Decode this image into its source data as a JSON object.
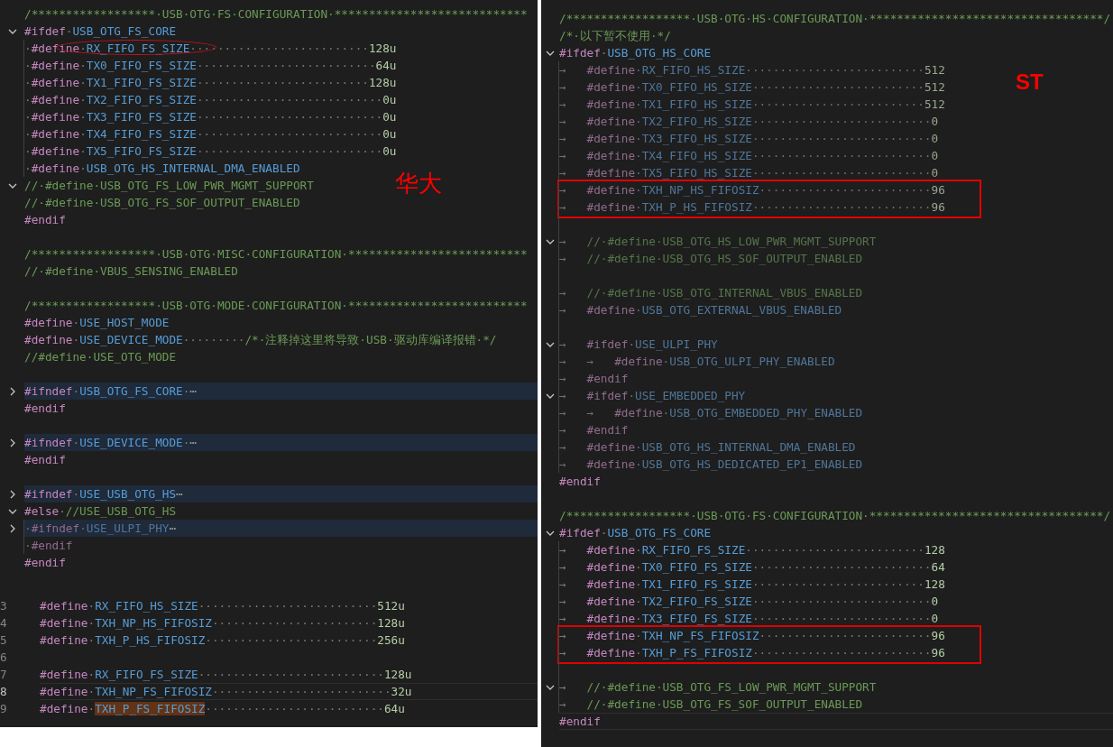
{
  "panels": [
    {
      "lines": [
        {
          "t": [
            {
              "kind": "cm",
              "text": "/******************·USB·OTG·FS·CONFIGURATION·****************************"
            }
          ]
        },
        {
          "expanded": true,
          "t": [
            {
              "kind": "dir",
              "text": "#ifdef"
            },
            {
              "kind": "ws",
              "text": "·"
            },
            {
              "kind": "mac",
              "text": "USB_OTG_FS_CORE"
            }
          ]
        },
        {
          "guide": true,
          "t": [
            {
              "kind": "ws",
              "text": "·"
            },
            {
              "kind": "dir",
              "text": "#define"
            },
            {
              "kind": "ws",
              "text": "·"
            },
            {
              "kind": "circ",
              "text": "RX_FIFO_FS_SIZE"
            },
            {
              "kind": "ws",
              "text": "··························"
            },
            {
              "kind": "num",
              "text": "128u"
            }
          ]
        },
        {
          "guide": true,
          "t": [
            {
              "kind": "ws",
              "text": "·"
            },
            {
              "kind": "dir",
              "text": "#define"
            },
            {
              "kind": "ws",
              "text": "·"
            },
            {
              "kind": "mac",
              "text": "TX0_FIFO_FS_SIZE"
            },
            {
              "kind": "ws",
              "text": "··························"
            },
            {
              "kind": "num",
              "text": "64u"
            }
          ]
        },
        {
          "guide": true,
          "t": [
            {
              "kind": "ws",
              "text": "·"
            },
            {
              "kind": "dir",
              "text": "#define"
            },
            {
              "kind": "ws",
              "text": "·"
            },
            {
              "kind": "mac",
              "text": "TX1_FIFO_FS_SIZE"
            },
            {
              "kind": "ws",
              "text": "·························"
            },
            {
              "kind": "num",
              "text": "128u"
            }
          ]
        },
        {
          "guide": true,
          "t": [
            {
              "kind": "ws",
              "text": "·"
            },
            {
              "kind": "dir",
              "text": "#define"
            },
            {
              "kind": "ws",
              "text": "·"
            },
            {
              "kind": "mac",
              "text": "TX2_FIFO_FS_SIZE"
            },
            {
              "kind": "ws",
              "text": "···························"
            },
            {
              "kind": "num",
              "text": "0u"
            }
          ]
        },
        {
          "guide": true,
          "t": [
            {
              "kind": "ws",
              "text": "·"
            },
            {
              "kind": "dir",
              "text": "#define"
            },
            {
              "kind": "ws",
              "text": "·"
            },
            {
              "kind": "mac",
              "text": "TX3_FIFO_FS_SIZE"
            },
            {
              "kind": "ws",
              "text": "···························"
            },
            {
              "kind": "num",
              "text": "0u"
            }
          ]
        },
        {
          "guide": true,
          "t": [
            {
              "kind": "ws",
              "text": "·"
            },
            {
              "kind": "dir",
              "text": "#define"
            },
            {
              "kind": "ws",
              "text": "·"
            },
            {
              "kind": "mac",
              "text": "TX4_FIFO_FS_SIZE"
            },
            {
              "kind": "ws",
              "text": "···························"
            },
            {
              "kind": "num",
              "text": "0u"
            }
          ]
        },
        {
          "guide": true,
          "t": [
            {
              "kind": "ws",
              "text": "·"
            },
            {
              "kind": "dir",
              "text": "#define"
            },
            {
              "kind": "ws",
              "text": "·"
            },
            {
              "kind": "mac",
              "text": "TX5_FIFO_FS_SIZE"
            },
            {
              "kind": "ws",
              "text": "···························"
            },
            {
              "kind": "num",
              "text": "0u"
            }
          ]
        },
        {
          "guide": true,
          "t": [
            {
              "kind": "ws",
              "text": "·"
            },
            {
              "kind": "dir",
              "text": "#define"
            },
            {
              "kind": "ws",
              "text": "·"
            },
            {
              "kind": "mac",
              "text": "USB_OTG_HS_INTERNAL_DMA_ENABLED"
            }
          ]
        },
        {
          "expanded": true,
          "note": "华大",
          "t": [
            {
              "kind": "cm",
              "text": "//·#define·USB_OTG_FS_LOW_PWR_MGMT_SUPPORT"
            }
          ]
        },
        {
          "t": [
            {
              "kind": "cm",
              "text": "//·#define·USB_OTG_FS_SOF_OUTPUT_ENABLED"
            }
          ]
        },
        {
          "t": [
            {
              "kind": "dir",
              "text": "#endif"
            }
          ]
        },
        {
          "gap": true,
          "t": [
            {
              "kind": "cm",
              "text": "/******************·USB·OTG·MISC·CONFIGURATION·**************************"
            }
          ]
        },
        {
          "t": [
            {
              "kind": "cm",
              "text": "//·#define·VBUS_SENSING_ENABLED"
            }
          ]
        },
        {
          "gap": true,
          "t": [
            {
              "kind": "cm",
              "text": "/******************·USB·OTG·MODE·CONFIGURATION·**************************"
            }
          ]
        },
        {
          "t": [
            {
              "kind": "dir",
              "text": "#define"
            },
            {
              "kind": "ws",
              "text": "·"
            },
            {
              "kind": "mac",
              "text": "USE_HOST_MODE"
            }
          ]
        },
        {
          "t": [
            {
              "kind": "dir",
              "text": "#define"
            },
            {
              "kind": "ws",
              "text": "·"
            },
            {
              "kind": "mac",
              "text": "USE_DEVICE_MODE"
            },
            {
              "kind": "ws",
              "text": "·········"
            },
            {
              "kind": "cm",
              "text": "/*·注释掉这里将导致·USB·驱动库编译报错·*/"
            }
          ]
        },
        {
          "t": [
            {
              "kind": "cm",
              "text": "//#define·USE_OTG_MODE"
            }
          ]
        },
        {
          "gap": true,
          "expanded": false,
          "hl": true,
          "t": [
            {
              "kind": "dir",
              "text": "#ifndef"
            },
            {
              "kind": "ws",
              "text": "·"
            },
            {
              "kind": "mac",
              "text": "USB_OTG_FS_CORE"
            },
            {
              "kind": "ws",
              "text": "·"
            },
            {
              "kind": "more",
              "text": "⋯"
            }
          ]
        },
        {
          "t": [
            {
              "kind": "dir",
              "text": "#endif"
            }
          ]
        },
        {
          "gap": true,
          "expanded": false,
          "hl": true,
          "t": [
            {
              "kind": "dir",
              "text": "#ifndef"
            },
            {
              "kind": "ws",
              "text": "·"
            },
            {
              "kind": "mac",
              "text": "USE_DEVICE_MODE"
            },
            {
              "kind": "ws",
              "text": "·"
            },
            {
              "kind": "more",
              "text": "⋯"
            }
          ]
        },
        {
          "t": [
            {
              "kind": "dir",
              "text": "#endif"
            }
          ]
        },
        {
          "gap": true,
          "expanded": false,
          "hl": true,
          "t": [
            {
              "kind": "dir",
              "text": "#ifndef"
            },
            {
              "kind": "ws",
              "text": "·"
            },
            {
              "kind": "mac",
              "text": "USE_USB_OTG_HS"
            },
            {
              "kind": "more",
              "text": "⋯"
            }
          ]
        },
        {
          "expanded": true,
          "t": [
            {
              "kind": "dir",
              "text": "#else"
            },
            {
              "kind": "ws",
              "text": "·"
            },
            {
              "kind": "cm",
              "text": "//USE_USB_OTG_HS"
            }
          ]
        },
        {
          "expanded": false,
          "hl": true,
          "guide": true,
          "inactive": true,
          "t": [
            {
              "kind": "ws",
              "text": "·"
            },
            {
              "kind": "dir",
              "text": "#ifndef"
            },
            {
              "kind": "ws",
              "text": "·"
            },
            {
              "kind": "mac",
              "text": "USE_ULPI_PHY"
            },
            {
              "kind": "more",
              "text": "⋯"
            }
          ]
        },
        {
          "guide": true,
          "inactive": true,
          "t": [
            {
              "kind": "ws",
              "text": "·"
            },
            {
              "kind": "dir",
              "text": "#endif"
            }
          ]
        },
        {
          "t": [
            {
              "kind": "dir",
              "text": "#endif"
            }
          ]
        }
      ]
    },
    {
      "lines": [
        {
          "n": "3",
          "t": [
            {
              "kind": "dir",
              "text": "#define"
            },
            {
              "kind": "ws",
              "text": "·"
            },
            {
              "kind": "mac",
              "text": "RX_FIFO_HS_SIZE"
            },
            {
              "kind": "ws",
              "text": "··························"
            },
            {
              "kind": "num",
              "text": "512u"
            }
          ]
        },
        {
          "n": "4",
          "t": [
            {
              "kind": "dir",
              "text": "#define"
            },
            {
              "kind": "ws",
              "text": "·"
            },
            {
              "kind": "mac",
              "text": "TXH_NP_HS_FIFOSIZ"
            },
            {
              "kind": "ws",
              "text": "························"
            },
            {
              "kind": "num",
              "text": "128u"
            }
          ]
        },
        {
          "n": "5",
          "t": [
            {
              "kind": "dir",
              "text": "#define"
            },
            {
              "kind": "ws",
              "text": "·"
            },
            {
              "kind": "mac",
              "text": "TXH_P_HS_FIFOSIZ"
            },
            {
              "kind": "ws",
              "text": "·························"
            },
            {
              "kind": "num",
              "text": "256u"
            }
          ]
        },
        {
          "n": "6"
        },
        {
          "n": "7",
          "t": [
            {
              "kind": "dir",
              "text": "#define"
            },
            {
              "kind": "ws",
              "text": "·"
            },
            {
              "kind": "mac",
              "text": "RX_FIFO_FS_SIZE"
            },
            {
              "kind": "ws",
              "text": "···························"
            },
            {
              "kind": "num",
              "text": "128u"
            }
          ]
        },
        {
          "n": "8",
          "current": true,
          "t": [
            {
              "kind": "dir",
              "text": "#define"
            },
            {
              "kind": "ws",
              "text": "·"
            },
            {
              "kind": "mac",
              "text": "TXH_NP_FS_FIFOSIZ"
            },
            {
              "kind": "ws",
              "text": "··························"
            },
            {
              "kind": "num",
              "text": "32u"
            }
          ]
        },
        {
          "n": "9",
          "t": [
            {
              "kind": "dir",
              "text": "#define"
            },
            {
              "kind": "ws",
              "text": "·"
            },
            {
              "kind": "sel",
              "text": "TXH_P_FS_FIFOSIZ"
            },
            {
              "kind": "ws",
              "text": "··························"
            },
            {
              "kind": "num",
              "text": "64u"
            }
          ]
        }
      ]
    },
    {
      "lines": [
        {
          "t": [
            {
              "kind": "cm",
              "text": "/******************·USB·OTG·HS·CONFIGURATION·**********************************/"
            }
          ]
        },
        {
          "t": [
            {
              "kind": "cm",
              "text": "/*·以下暂不使用·*/"
            }
          ]
        },
        {
          "expanded": true,
          "t": [
            {
              "kind": "dir",
              "text": "#ifdef"
            },
            {
              "kind": "ws",
              "text": "·"
            },
            {
              "kind": "mac",
              "text": "USB_OTG_HS_CORE"
            }
          ]
        },
        {
          "guide": true,
          "inactive": true,
          "t": [
            {
              "kind": "tab",
              "text": "→   "
            },
            {
              "kind": "dir",
              "text": "#define"
            },
            {
              "kind": "ws",
              "text": "·"
            },
            {
              "kind": "mac",
              "text": "RX_FIFO_HS_SIZE"
            },
            {
              "kind": "ws",
              "text": "··························"
            },
            {
              "kind": "num",
              "text": "512"
            }
          ]
        },
        {
          "guide": true,
          "inactive": true,
          "note": "ST",
          "t": [
            {
              "kind": "tab",
              "text": "→   "
            },
            {
              "kind": "dir",
              "text": "#define"
            },
            {
              "kind": "ws",
              "text": "·"
            },
            {
              "kind": "mac",
              "text": "TX0_FIFO_HS_SIZE"
            },
            {
              "kind": "ws",
              "text": "·························"
            },
            {
              "kind": "num",
              "text": "512"
            }
          ]
        },
        {
          "guide": true,
          "inactive": true,
          "t": [
            {
              "kind": "tab",
              "text": "→   "
            },
            {
              "kind": "dir",
              "text": "#define"
            },
            {
              "kind": "ws",
              "text": "·"
            },
            {
              "kind": "mac",
              "text": "TX1_FIFO_HS_SIZE"
            },
            {
              "kind": "ws",
              "text": "·························"
            },
            {
              "kind": "num",
              "text": "512"
            }
          ]
        },
        {
          "guide": true,
          "inactive": true,
          "t": [
            {
              "kind": "tab",
              "text": "→   "
            },
            {
              "kind": "dir",
              "text": "#define"
            },
            {
              "kind": "ws",
              "text": "·"
            },
            {
              "kind": "mac",
              "text": "TX2_FIFO_HS_SIZE"
            },
            {
              "kind": "ws",
              "text": "··························"
            },
            {
              "kind": "num",
              "text": "0"
            }
          ]
        },
        {
          "guide": true,
          "inactive": true,
          "t": [
            {
              "kind": "tab",
              "text": "→   "
            },
            {
              "kind": "dir",
              "text": "#define"
            },
            {
              "kind": "ws",
              "text": "·"
            },
            {
              "kind": "mac",
              "text": "TX3_FIFO_HS_SIZE"
            },
            {
              "kind": "ws",
              "text": "··························"
            },
            {
              "kind": "num",
              "text": "0"
            }
          ]
        },
        {
          "guide": true,
          "inactive": true,
          "t": [
            {
              "kind": "tab",
              "text": "→   "
            },
            {
              "kind": "dir",
              "text": "#define"
            },
            {
              "kind": "ws",
              "text": "·"
            },
            {
              "kind": "mac",
              "text": "TX4_FIFO_HS_SIZE"
            },
            {
              "kind": "ws",
              "text": "··························"
            },
            {
              "kind": "num",
              "text": "0"
            }
          ]
        },
        {
          "guide": true,
          "inactive": true,
          "t": [
            {
              "kind": "tab",
              "text": "→   "
            },
            {
              "kind": "dir",
              "text": "#define"
            },
            {
              "kind": "ws",
              "text": "·"
            },
            {
              "kind": "mac",
              "text": "TX5_FIFO_HS_SIZE"
            },
            {
              "kind": "ws",
              "text": "··························"
            },
            {
              "kind": "num",
              "text": "0"
            }
          ]
        },
        {
          "guide": true,
          "inactive": true,
          "boxed": true,
          "t": [
            {
              "kind": "tab",
              "text": "→   "
            },
            {
              "kind": "dir",
              "text": "#define"
            },
            {
              "kind": "ws",
              "text": "·"
            },
            {
              "kind": "mac",
              "text": "TXH_NP_HS_FIFOSIZ"
            },
            {
              "kind": "ws",
              "text": "·························"
            },
            {
              "kind": "num",
              "text": "96"
            }
          ]
        },
        {
          "guide": true,
          "inactive": true,
          "boxed": true,
          "t": [
            {
              "kind": "tab",
              "text": "→   "
            },
            {
              "kind": "dir",
              "text": "#define"
            },
            {
              "kind": "ws",
              "text": "·"
            },
            {
              "kind": "mac",
              "text": "TXH_P_HS_FIFOSIZ"
            },
            {
              "kind": "ws",
              "text": "··························"
            },
            {
              "kind": "num",
              "text": "96"
            }
          ]
        },
        {
          "guide": true
        },
        {
          "expanded": true,
          "guide": true,
          "inactive": true,
          "t": [
            {
              "kind": "tab",
              "text": "→   "
            },
            {
              "kind": "cm",
              "text": "//·#define·USB_OTG_HS_LOW_PWR_MGMT_SUPPORT"
            }
          ]
        },
        {
          "guide": true,
          "inactive": true,
          "t": [
            {
              "kind": "tab",
              "text": "→   "
            },
            {
              "kind": "cm",
              "text": "//·#define·USB_OTG_HS_SOF_OUTPUT_ENABLED"
            }
          ]
        },
        {
          "guide": true
        },
        {
          "guide": true,
          "inactive": true,
          "t": [
            {
              "kind": "tab",
              "text": "→   "
            },
            {
              "kind": "cm",
              "text": "//·#define·USB_OTG_INTERNAL_VBUS_ENABLED"
            }
          ]
        },
        {
          "guide": true,
          "inactive": true,
          "t": [
            {
              "kind": "tab",
              "text": "→   "
            },
            {
              "kind": "dir",
              "text": "#define"
            },
            {
              "kind": "ws",
              "text": "·"
            },
            {
              "kind": "mac",
              "text": "USB_OTG_EXTERNAL_VBUS_ENABLED"
            }
          ]
        },
        {
          "guide": true
        },
        {
          "expanded": true,
          "guide": true,
          "inactive": true,
          "t": [
            {
              "kind": "tab",
              "text": "→   "
            },
            {
              "kind": "dir",
              "text": "#ifdef"
            },
            {
              "kind": "ws",
              "text": "·"
            },
            {
              "kind": "mac",
              "text": "USE_ULPI_PHY"
            }
          ]
        },
        {
          "guide": true,
          "inactive": true,
          "t": [
            {
              "kind": "tab",
              "text": "→   "
            },
            {
              "kind": "tab",
              "text": "→   "
            },
            {
              "kind": "dir",
              "text": "#define"
            },
            {
              "kind": "ws",
              "text": "·"
            },
            {
              "kind": "mac",
              "text": "USB_OTG_ULPI_PHY_ENABLED"
            }
          ]
        },
        {
          "guide": true,
          "inactive": true,
          "t": [
            {
              "kind": "tab",
              "text": "→   "
            },
            {
              "kind": "dir",
              "text": "#endif"
            }
          ]
        },
        {
          "expanded": true,
          "guide": true,
          "inactive": true,
          "t": [
            {
              "kind": "tab",
              "text": "→   "
            },
            {
              "kind": "dir",
              "text": "#ifdef"
            },
            {
              "kind": "ws",
              "text": "·"
            },
            {
              "kind": "mac",
              "text": "USE_EMBEDDED_PHY"
            }
          ]
        },
        {
          "guide": true,
          "inactive": true,
          "t": [
            {
              "kind": "tab",
              "text": "→   "
            },
            {
              "kind": "tab",
              "text": "→   "
            },
            {
              "kind": "dir",
              "text": "#define"
            },
            {
              "kind": "ws",
              "text": "·"
            },
            {
              "kind": "mac",
              "text": "USB_OTG_EMBEDDED_PHY_ENABLED"
            }
          ]
        },
        {
          "guide": true,
          "inactive": true,
          "t": [
            {
              "kind": "tab",
              "text": "→   "
            },
            {
              "kind": "dir",
              "text": "#endif"
            }
          ]
        },
        {
          "guide": true,
          "inactive": true,
          "t": [
            {
              "kind": "tab",
              "text": "→   "
            },
            {
              "kind": "dir",
              "text": "#define"
            },
            {
              "kind": "ws",
              "text": "·"
            },
            {
              "kind": "mac",
              "text": "USB_OTG_HS_INTERNAL_DMA_ENABLED"
            }
          ]
        },
        {
          "guide": true,
          "inactive": true,
          "t": [
            {
              "kind": "tab",
              "text": "→   "
            },
            {
              "kind": "dir",
              "text": "#define"
            },
            {
              "kind": "ws",
              "text": "·"
            },
            {
              "kind": "mac",
              "text": "USB_OTG_HS_DEDICATED_EP1_ENABLED"
            }
          ]
        },
        {
          "t": [
            {
              "kind": "dir",
              "text": "#endif"
            }
          ]
        },
        {
          "gap": true,
          "t": [
            {
              "kind": "cm",
              "text": "/******************·USB·OTG·FS·CONFIGURATION·**********************************/"
            }
          ]
        },
        {
          "expanded": true,
          "t": [
            {
              "kind": "dir",
              "text": "#ifdef"
            },
            {
              "kind": "ws",
              "text": "·"
            },
            {
              "kind": "mac",
              "text": "USB_OTG_FS_CORE"
            }
          ]
        },
        {
          "guide": true,
          "t": [
            {
              "kind": "tab",
              "text": "→   "
            },
            {
              "kind": "dir",
              "text": "#define"
            },
            {
              "kind": "ws",
              "text": "·"
            },
            {
              "kind": "mac",
              "text": "RX_FIFO_FS_SIZE"
            },
            {
              "kind": "ws",
              "text": "··························"
            },
            {
              "kind": "num",
              "text": "128"
            }
          ]
        },
        {
          "guide": true,
          "t": [
            {
              "kind": "tab",
              "text": "→   "
            },
            {
              "kind": "dir",
              "text": "#define"
            },
            {
              "kind": "ws",
              "text": "·"
            },
            {
              "kind": "mac",
              "text": "TX0_FIFO_FS_SIZE"
            },
            {
              "kind": "ws",
              "text": "··························"
            },
            {
              "kind": "num",
              "text": "64"
            }
          ]
        },
        {
          "guide": true,
          "t": [
            {
              "kind": "tab",
              "text": "→   "
            },
            {
              "kind": "dir",
              "text": "#define"
            },
            {
              "kind": "ws",
              "text": "·"
            },
            {
              "kind": "mac",
              "text": "TX1_FIFO_FS_SIZE"
            },
            {
              "kind": "ws",
              "text": "·························"
            },
            {
              "kind": "num",
              "text": "128"
            }
          ]
        },
        {
          "guide": true,
          "t": [
            {
              "kind": "tab",
              "text": "→   "
            },
            {
              "kind": "dir",
              "text": "#define"
            },
            {
              "kind": "ws",
              "text": "·"
            },
            {
              "kind": "mac",
              "text": "TX2_FIFO_FS_SIZE"
            },
            {
              "kind": "ws",
              "text": "··························"
            },
            {
              "kind": "num",
              "text": "0"
            }
          ]
        },
        {
          "guide": true,
          "t": [
            {
              "kind": "tab",
              "text": "→   "
            },
            {
              "kind": "dir",
              "text": "#define"
            },
            {
              "kind": "ws",
              "text": "·"
            },
            {
              "kind": "mac",
              "text": "TX3_FIFO_FS_SIZE"
            },
            {
              "kind": "ws",
              "text": "··························"
            },
            {
              "kind": "num",
              "text": "0"
            }
          ]
        },
        {
          "guide": true,
          "boxed": true,
          "t": [
            {
              "kind": "tab",
              "text": "→   "
            },
            {
              "kind": "dir",
              "text": "#define"
            },
            {
              "kind": "ws",
              "text": "·"
            },
            {
              "kind": "mac",
              "text": "TXH_NP_FS_FIFOSIZ"
            },
            {
              "kind": "ws",
              "text": "·························"
            },
            {
              "kind": "num",
              "text": "96"
            }
          ]
        },
        {
          "guide": true,
          "boxed": true,
          "t": [
            {
              "kind": "tab",
              "text": "→   "
            },
            {
              "kind": "dir",
              "text": "#define"
            },
            {
              "kind": "ws",
              "text": "·"
            },
            {
              "kind": "mac",
              "text": "TXH_P_FS_FIFOSIZ"
            },
            {
              "kind": "ws",
              "text": "··························"
            },
            {
              "kind": "num",
              "text": "96"
            }
          ]
        },
        {
          "guide": true
        },
        {
          "expanded": true,
          "guide": true,
          "t": [
            {
              "kind": "tab",
              "text": "→   "
            },
            {
              "kind": "cm",
              "text": "//·#define·USB_OTG_FS_LOW_PWR_MGMT_SUPPORT"
            }
          ]
        },
        {
          "guide": true,
          "t": [
            {
              "kind": "tab",
              "text": "→   "
            },
            {
              "kind": "cm",
              "text": "//·#define·USB_OTG_FS_SOF_OUTPUT_ENABLED"
            }
          ]
        },
        {
          "current": true,
          "t": [
            {
              "kind": "dir",
              "text": "#endif"
            }
          ]
        }
      ]
    }
  ]
}
